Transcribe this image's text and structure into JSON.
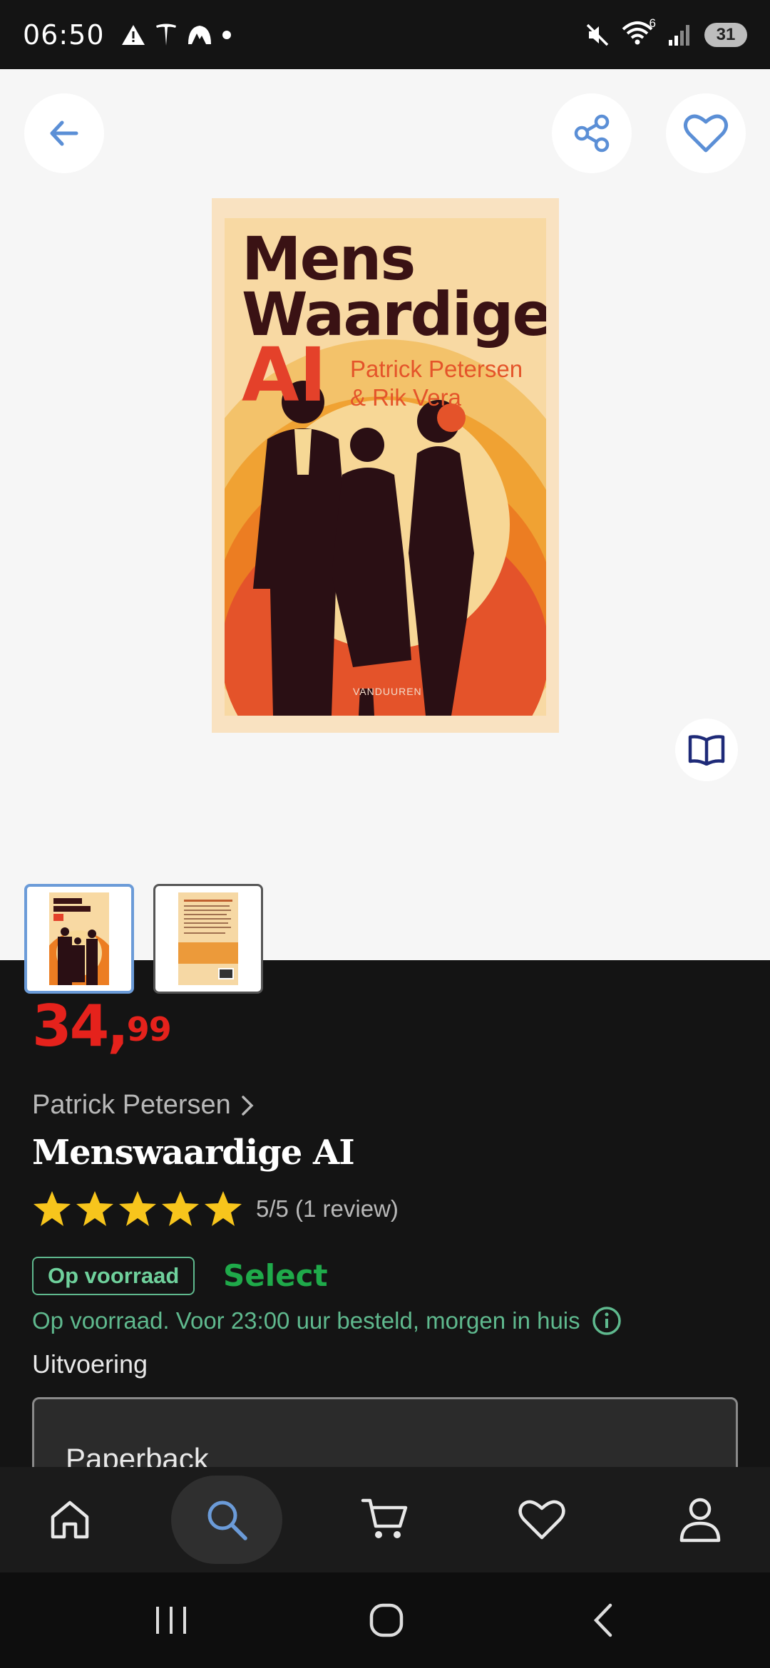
{
  "status_bar": {
    "time": "06:50",
    "battery": "31",
    "network_label": "6"
  },
  "header": {
    "back_icon": "arrow-left-icon",
    "share_icon": "share-icon",
    "favorite_icon": "heart-icon"
  },
  "cover": {
    "title_line1": "Mens",
    "title_line2": "Waardige",
    "title_line3": "AI",
    "authors_line1": "Patrick Petersen",
    "authors_line2": "& Rik Vera",
    "publisher": "VANDUUREN"
  },
  "thumbnails": [
    {
      "name": "front-cover",
      "selected": true
    },
    {
      "name": "back-cover",
      "selected": false
    }
  ],
  "product": {
    "price_main": "34,",
    "price_cents": "99",
    "author": "Patrick Petersen",
    "title": "Menswaardige AI",
    "rating_stars": 5,
    "rating_text": "5/5 (1 review)",
    "stock_badge": "Op voorraad",
    "select_label": "Select",
    "delivery_text": "Op voorraad. Voor 23:00 uur besteld, morgen in huis",
    "variant_label": "Uitvoering",
    "variant_value": "Paperback"
  },
  "bottom_nav": [
    {
      "icon": "home-icon",
      "active": false
    },
    {
      "icon": "search-icon",
      "active": true
    },
    {
      "icon": "cart-icon",
      "active": false
    },
    {
      "icon": "heart-icon",
      "active": false
    },
    {
      "icon": "profile-icon",
      "active": false
    }
  ],
  "colors": {
    "accent_blue": "#6b9bd8",
    "price_red": "#e5221c",
    "stock_green": "#5fb98e",
    "select_green": "#1faa4a",
    "star_yellow": "#f7c51c"
  }
}
